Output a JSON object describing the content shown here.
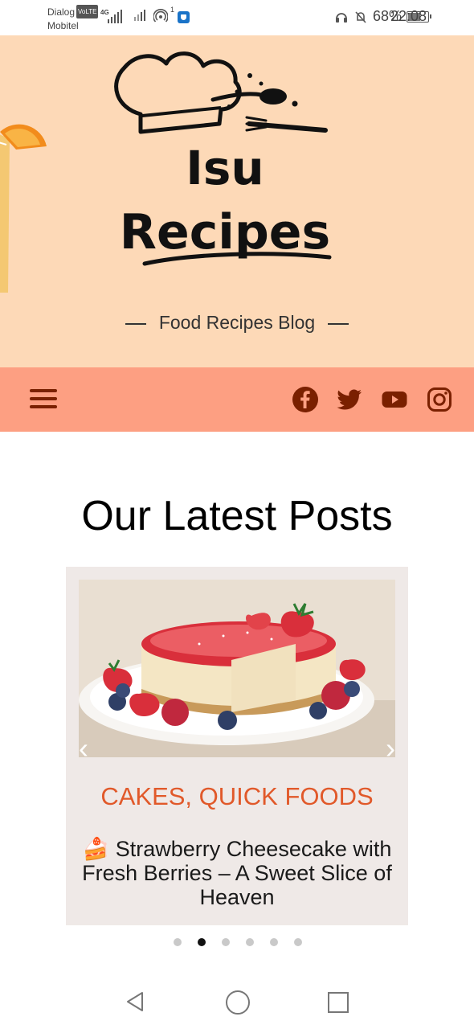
{
  "status_bar": {
    "carrier_1": "Dialog",
    "volte_badge": "VoLTE",
    "carrier_2": "Mobitel",
    "network": "4G",
    "hotspot_count": "1",
    "battery": "68%",
    "battery_level": 0.68,
    "time": "22:08"
  },
  "header": {
    "logo_line_1": "Isu",
    "logo_line_2": "Recipes",
    "tagline": "Food Recipes Blog",
    "background": "#fdd9b7"
  },
  "nav": {
    "background": "#fd9f82",
    "menu_icon": "hamburger-icon",
    "social_icons": [
      "facebook-icon",
      "twitter-icon",
      "youtube-icon",
      "instagram-icon"
    ],
    "icon_color": "#7a2000"
  },
  "main": {
    "section_title": "Our Latest Posts",
    "post": {
      "categories": "CAKES, QUICK FOODS",
      "emoji": "🍰",
      "title": "Strawberry Cheesecake with Fresh Berries – A Sweet Slice of Heaven",
      "category_color": "#e1592a"
    },
    "carousel": {
      "prev": "‹",
      "next": "›",
      "slide_count": 6,
      "active_index": 1
    }
  },
  "system_nav": {
    "back": "back-icon",
    "home": "home-icon",
    "recents": "recents-icon"
  }
}
